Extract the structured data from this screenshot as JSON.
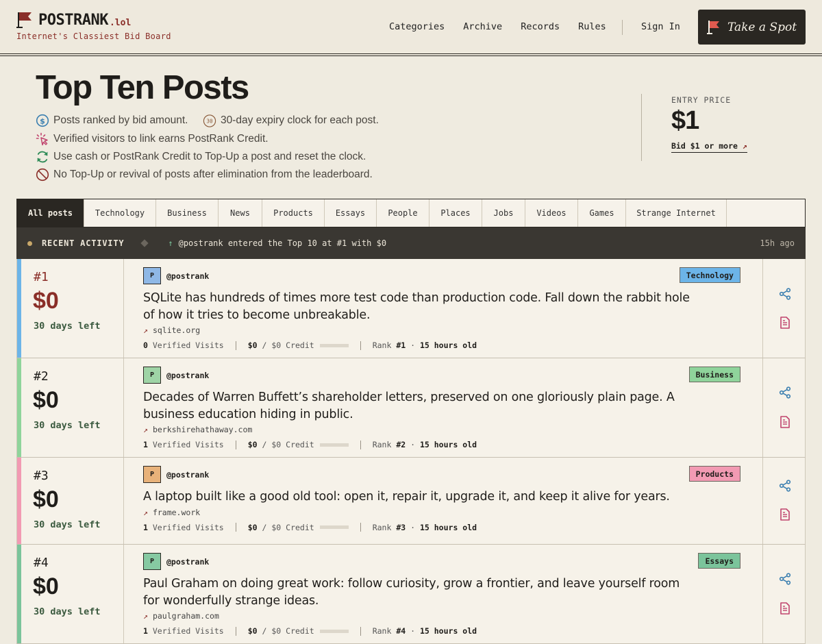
{
  "header": {
    "brand": "POSTRANK",
    "tld": ".lol",
    "tagline": "Internet's Classiest Bid Board",
    "nav": [
      "Categories",
      "Archive",
      "Records",
      "Rules"
    ],
    "sign_in": "Sign In",
    "cta": "Take a Spot"
  },
  "hero": {
    "title": "Top Ten Posts",
    "features": [
      {
        "icon": "dollar-coin-icon",
        "text": "Posts ranked by bid amount."
      },
      {
        "icon": "clock-30-icon",
        "badge": "30",
        "text": "30-day expiry clock for each post."
      },
      {
        "icon": "click-sparkle-icon",
        "text": "Verified visitors to link earns PostRank Credit."
      },
      {
        "icon": "refresh-icon",
        "text": "Use cash or PostRank Credit to Top-Up a post and reset the clock."
      },
      {
        "icon": "no-entry-icon",
        "text": "No Top-Up or revival of posts after elimination from the leaderboard."
      }
    ],
    "entry": {
      "label": "ENTRY PRICE",
      "price": "$1",
      "link": "Bid $1 or more",
      "link_arrow": "↗"
    }
  },
  "tabs": [
    "All posts",
    "Technology",
    "Business",
    "News",
    "Products",
    "Essays",
    "People",
    "Places",
    "Jobs",
    "Videos",
    "Games",
    "Strange Internet"
  ],
  "activity": {
    "label": "RECENT ACTIVITY",
    "arrow": "↑",
    "message": "@postrank entered the Top 10 at #1 with $0",
    "time": "15h ago"
  },
  "posts": [
    {
      "rank": "#1",
      "price": "$0",
      "days": "30 days left",
      "avatar": "P",
      "handle": "@postrank",
      "category": "Technology",
      "category_color": "#6cb4e8",
      "stripe_color": "#6cb4e8",
      "title": "SQLite has hundreds of times more test code than production code. Fall down the rabbit hole of how it tries to become unbreakable.",
      "domain": "sqlite.org",
      "visits": "0",
      "visits_label": "Verified Visits",
      "bid": "$0",
      "credit": "/ $0 Credit",
      "credit_fill": 0,
      "rank_label": "Rank",
      "rank_value": "#1",
      "age": "15 hours old"
    },
    {
      "rank": "#2",
      "price": "$0",
      "days": "30 days left",
      "avatar": "P",
      "handle": "@postrank",
      "category": "Business",
      "category_color": "#8fd49b",
      "stripe_color": "#8fd49b",
      "title": "Decades of Warren Buffett’s shareholder letters, preserved on one gloriously plain page. A business education hiding in public.",
      "domain": "berkshirehathaway.com",
      "visits": "1",
      "visits_label": "Verified Visits",
      "bid": "$0",
      "credit": "/ $0 Credit",
      "credit_fill": 0,
      "rank_label": "Rank",
      "rank_value": "#2",
      "age": "15 hours old"
    },
    {
      "rank": "#3",
      "price": "$0",
      "days": "30 days left",
      "avatar": "P",
      "handle": "@postrank",
      "category": "Products",
      "category_color": "#f29ab3",
      "stripe_color": "#f29ab3",
      "title": "A laptop built like a good old tool: open it, repair it, upgrade it, and keep it alive for years.",
      "domain": "frame.work",
      "visits": "1",
      "visits_label": "Verified Visits",
      "bid": "$0",
      "credit": "/ $0 Credit",
      "credit_fill": 0,
      "rank_label": "Rank",
      "rank_value": "#3",
      "age": "15 hours old"
    },
    {
      "rank": "#4",
      "price": "$0",
      "days": "30 days left",
      "avatar": "P",
      "handle": "@postrank",
      "category": "Essays",
      "category_color": "#7bc49b",
      "stripe_color": "#7bc49b",
      "title": "Paul Graham on doing great work: follow curiosity, grow a frontier, and leave yourself room for wonderfully strange ideas.",
      "domain": "paulgraham.com",
      "visits": "1",
      "visits_label": "Verified Visits",
      "bid": "$0",
      "credit": "/ $0 Credit",
      "credit_fill": 0,
      "rank_label": "Rank",
      "rank_value": "#4",
      "age": "15 hours old"
    }
  ],
  "colors": {
    "accent": "#8a2e28",
    "dark": "#2a2722",
    "background": "#efebe0",
    "share_icon": "#3b7fb0",
    "doc_icon": "#c0446e"
  }
}
